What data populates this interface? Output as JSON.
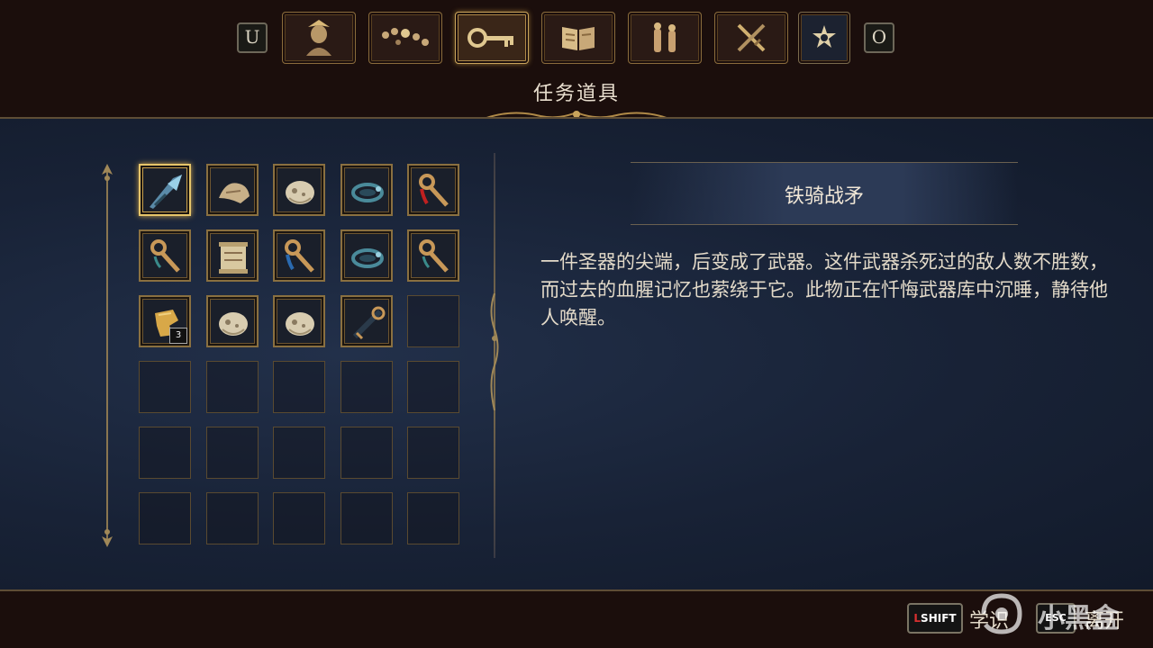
{
  "top": {
    "prev_key": "U",
    "next_key": "O",
    "tabs": [
      {
        "icon": "portrait-icon"
      },
      {
        "icon": "rosary-beads-icon"
      },
      {
        "icon": "key-icon",
        "active": true
      },
      {
        "icon": "book-icon"
      },
      {
        "icon": "figures-icon"
      },
      {
        "icon": "crossed-swords-icon"
      },
      {
        "icon": "star-gear-icon"
      }
    ],
    "title": "任务道具"
  },
  "grid": {
    "rows": 6,
    "cols": 5,
    "items": [
      {
        "icon": "spear-tip-icon",
        "selected": true
      },
      {
        "icon": "cloth-scrap-icon"
      },
      {
        "icon": "skull-shard-icon"
      },
      {
        "icon": "blue-rosary-icon"
      },
      {
        "icon": "red-key-icon"
      },
      {
        "icon": "ornate-key-icon"
      },
      {
        "icon": "scroll-icon"
      },
      {
        "icon": "blue-key-icon"
      },
      {
        "icon": "blue-rosary-icon"
      },
      {
        "icon": "ornate-key-icon"
      },
      {
        "icon": "gold-relic-icon",
        "count": "3"
      },
      {
        "icon": "skull-shard-icon"
      },
      {
        "icon": "skull-shard-icon"
      },
      {
        "icon": "dark-key-icon"
      }
    ]
  },
  "detail": {
    "name": "铁骑战矛",
    "description": "一件圣器的尖端，后变成了武器。这件武器杀死过的敌人数不胜数，而过去的血腥记忆也萦绕于它。此物正在忏悔武器库中沉睡，静待他人唤醒。"
  },
  "bottom": {
    "shift_key": "SHIFT",
    "shift_label": "学识",
    "esc_key": "ESC",
    "esc_label": "离开",
    "watermark": "小黑盒"
  },
  "colors": {
    "gold": "#c9a45c",
    "panel_blue": "#182236",
    "frame_dark": "#1b0e0c"
  }
}
